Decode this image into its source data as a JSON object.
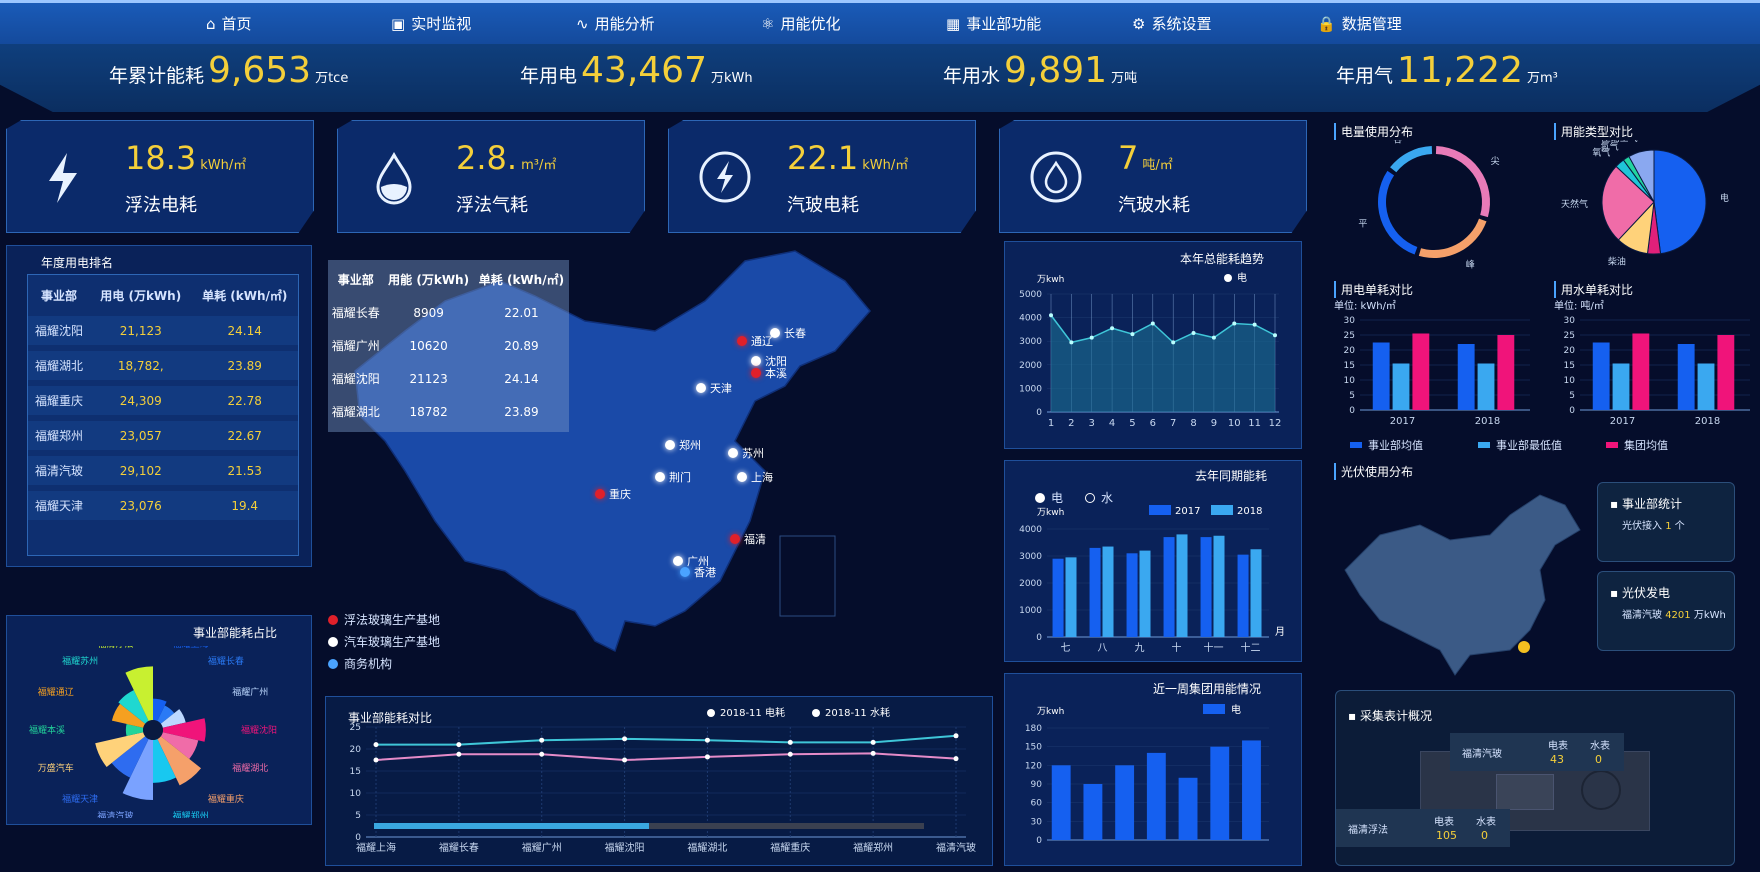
{
  "nav": [
    {
      "label": "首页",
      "icon": "home-icon"
    },
    {
      "label": "实时监视",
      "icon": "monitor-icon"
    },
    {
      "label": "用能分析",
      "icon": "pulse-icon"
    },
    {
      "label": "用能优化",
      "icon": "optimize-icon"
    },
    {
      "label": "事业部功能",
      "icon": "grid-icon"
    },
    {
      "label": "系统设置",
      "icon": "gear-icon"
    },
    {
      "label": "数据管理",
      "icon": "lock-icon"
    }
  ],
  "summary": [
    {
      "label": "年累计能耗",
      "value": "9,653",
      "unit": "万tce"
    },
    {
      "label": "年用电",
      "value": "43,467",
      "unit": "万kWh"
    },
    {
      "label": "年用水",
      "value": "9,891",
      "unit": "万吨"
    },
    {
      "label": "年用气",
      "value": "11,222",
      "unit": "万m³"
    }
  ],
  "kpis": [
    {
      "value": "18.3",
      "unit": "kWh/㎡",
      "label": "浮法电耗",
      "icon": "lightning-icon"
    },
    {
      "value": "2.8.",
      "unit": "m³/㎡",
      "label": "浮法气耗",
      "icon": "water-drop-icon"
    },
    {
      "value": "22.1",
      "unit": "kWh/㎡",
      "label": "汽玻电耗",
      "icon": "power-circle-icon"
    },
    {
      "value": "7",
      "unit": "吨/㎡",
      "label": "汽玻水耗",
      "icon": "water-circle-icon"
    }
  ],
  "ranking": {
    "title": "年度用电排名",
    "headers": [
      "事业部",
      "用电 (万kWh)",
      "单耗 (kWh/㎡)"
    ],
    "rows": [
      [
        "福耀沈阳",
        "21,123",
        "24.14"
      ],
      [
        "福耀湖北",
        "18,782,",
        "23.89"
      ],
      [
        "福耀重庆",
        "24,309",
        "22.78"
      ],
      [
        "福耀郑州",
        "23,057",
        "22.67"
      ],
      [
        "福清汽玻",
        "29,102",
        "21.53"
      ],
      [
        "福耀天津",
        "23,076",
        "19.4"
      ]
    ]
  },
  "map": {
    "overlay": {
      "headers": [
        "事业部",
        "用能 (万kWh)",
        "单耗 (kWh/㎡)"
      ],
      "rows": [
        [
          "福耀长春",
          "8909",
          "22.01"
        ],
        [
          "福耀广州",
          "10620",
          "20.89"
        ],
        [
          "福耀沈阳",
          "21123",
          "24.14"
        ],
        [
          "福耀湖北",
          "18782",
          "23.89"
        ]
      ]
    },
    "legend": [
      {
        "label": "浮法玻璃生产基地",
        "color": "#e0202a"
      },
      {
        "label": "汽车玻璃生产基地",
        "color": "#ffffff"
      },
      {
        "label": "商务机构",
        "color": "#4aa3ff"
      }
    ],
    "cities": [
      {
        "name": "长春",
        "type": 1
      },
      {
        "name": "通辽",
        "type": 0
      },
      {
        "name": "沈阳",
        "type": 1
      },
      {
        "name": "本溪",
        "type": 0
      },
      {
        "name": "天津",
        "type": 1
      },
      {
        "name": "郑州",
        "type": 1
      },
      {
        "name": "苏州",
        "type": 1
      },
      {
        "name": "荆门",
        "type": 1
      },
      {
        "name": "上海",
        "type": 1
      },
      {
        "name": "重庆",
        "type": 0
      },
      {
        "name": "福清",
        "type": 0
      },
      {
        "name": "广州",
        "type": 1
      },
      {
        "name": "香港",
        "type": 2
      }
    ]
  },
  "rose": {
    "title": "事业部能耗占比"
  },
  "trend": {
    "title": "本年总能耗趋势"
  },
  "lastyear": {
    "title": "去年同期能耗",
    "toggle": [
      {
        "label": "电",
        "active": true
      },
      {
        "label": "水",
        "active": false
      }
    ]
  },
  "week": {
    "title": "近一周集团用能情况"
  },
  "compare": {
    "title": "事业部能耗对比"
  },
  "right": {
    "donut_title": "电量使用分布",
    "pie_title": "用能类型对比",
    "elec_title": "用电单耗对比",
    "elec_unit": "单位: kWh/㎡",
    "water_title": "用水单耗对比",
    "water_unit": "单位: 吨/㎡",
    "bar_legend": [
      {
        "label": "事业部均值",
        "color": "#1560f0"
      },
      {
        "label": "事业部最低值",
        "color": "#3aa8f0"
      },
      {
        "label": "集团均值",
        "color": "#f0147a"
      }
    ]
  },
  "pv": {
    "title": "光伏使用分布",
    "stat_title": "事业部统计",
    "stat_label": "光伏接入",
    "stat_value": "1",
    "stat_unit": "个",
    "gen_title": "光伏发电",
    "gen_label": "福清汽玻",
    "gen_value": "4201",
    "gen_unit": "万kWh"
  },
  "meters": {
    "title": "采集表计概况",
    "sites": [
      {
        "name": "福清汽玻",
        "elec_label": "电表",
        "elec": "43",
        "water_label": "水表",
        "water": "0"
      },
      {
        "name": "福清浮法",
        "elec_label": "电表",
        "elec": "105",
        "water_label": "水表",
        "water": "0"
      }
    ]
  },
  "chart_data": [
    {
      "id": "trend",
      "type": "area",
      "ylabel": "万kwh",
      "x": [
        "1",
        "2",
        "3",
        "4",
        "5",
        "6",
        "7",
        "8",
        "9",
        "10",
        "11",
        "12"
      ],
      "series": [
        {
          "name": "电",
          "values": [
            4100,
            2950,
            3150,
            3550,
            3300,
            3750,
            2950,
            3350,
            3150,
            3750,
            3700,
            3250
          ]
        }
      ],
      "ylim": [
        0,
        5000
      ],
      "yticks": [
        0,
        1000,
        2000,
        3000,
        4000,
        5000
      ],
      "color": "#3fc6d8",
      "legend": "top-right"
    },
    {
      "id": "lastyear",
      "type": "bar",
      "ylabel": "万kwh",
      "xlabel": "月",
      "categories": [
        "七",
        "八",
        "九",
        "十",
        "十一",
        "十二"
      ],
      "series": [
        {
          "name": "2017",
          "values": [
            2900,
            3300,
            3100,
            3700,
            3700,
            3050
          ],
          "color": "#1560f0"
        },
        {
          "name": "2018",
          "values": [
            2950,
            3350,
            3200,
            3800,
            3750,
            3250
          ],
          "color": "#3aa8f0"
        }
      ],
      "ylim": [
        0,
        4000
      ],
      "yticks": [
        0,
        1000,
        2000,
        3000,
        4000
      ],
      "legend": "top-right"
    },
    {
      "id": "week",
      "type": "bar",
      "ylabel": "万kwh",
      "categories": [
        "",
        "",
        "",
        "",
        "",
        "",
        ""
      ],
      "series": [
        {
          "name": "电",
          "values": [
            120,
            90,
            120,
            140,
            100,
            150,
            160
          ],
          "color": "#1560f0"
        }
      ],
      "ylim": [
        0,
        180
      ],
      "yticks": [
        0,
        30,
        60,
        90,
        120,
        150,
        180
      ],
      "legend": "top-right"
    },
    {
      "id": "compare",
      "type": "line",
      "categories": [
        "福耀上海",
        "福耀长春",
        "福耀广州",
        "福耀沈阳",
        "福耀湖北",
        "福耀重庆",
        "福耀郑州",
        "福清汽玻"
      ],
      "series": [
        {
          "name": "2018-11 电耗",
          "values": [
            21,
            21,
            22,
            22.3,
            22,
            21.5,
            21.5,
            23
          ],
          "color": "#3fc6d8"
        },
        {
          "name": "2018-11 水耗",
          "values": [
            17.5,
            18.8,
            18.8,
            17.5,
            18.2,
            18.8,
            19,
            17.8
          ],
          "color": "#e58cc8"
        }
      ],
      "ylim": [
        0,
        25
      ],
      "yticks": [
        0,
        5,
        10,
        15,
        20,
        25
      ],
      "zoom_range": [
        0,
        50
      ],
      "legend": "top-right"
    },
    {
      "id": "elec",
      "type": "bar",
      "categories": [
        "2017",
        "2018"
      ],
      "series": [
        {
          "name": "事业部均值",
          "values": [
            22.5,
            22
          ]
        },
        {
          "name": "事业部最低值",
          "values": [
            15.5,
            15.5
          ]
        },
        {
          "name": "集团均值",
          "values": [
            25.5,
            25
          ]
        }
      ],
      "ylim": [
        0,
        30
      ],
      "yticks": [
        0,
        5,
        10,
        15,
        20,
        25,
        30
      ]
    },
    {
      "id": "water",
      "type": "bar",
      "categories": [
        "2017",
        "2018"
      ],
      "series": [
        {
          "name": "事业部均值",
          "values": [
            22.5,
            22
          ]
        },
        {
          "name": "事业部最低值",
          "values": [
            15.5,
            15.5
          ]
        },
        {
          "name": "集团均值",
          "values": [
            25.5,
            25
          ]
        }
      ],
      "ylim": [
        0,
        30
      ],
      "yticks": [
        0,
        5,
        10,
        15,
        20,
        25,
        30
      ]
    },
    {
      "id": "donut",
      "type": "pie",
      "labels": [
        "尖",
        "峰",
        "平",
        "谷"
      ],
      "values": [
        30,
        25,
        30,
        15
      ],
      "colors": [
        "#e87bb8",
        "#f5a06a",
        "#1560f0",
        "#3aa8f0"
      ]
    },
    {
      "id": "pie",
      "type": "pie",
      "labels": [
        "电",
        "",
        "柴油",
        "天然气",
        "氧气",
        "氮气",
        "压缩空气"
      ],
      "values": [
        48,
        4,
        10,
        25,
        3,
        2,
        8
      ],
      "colors": [
        "#1560f0",
        "#e0207a",
        "#ffd27a",
        "#f06ca8",
        "#1fc6d8",
        "#22d4a0",
        "#8aa8f0"
      ]
    },
    {
      "id": "rose",
      "type": "pie",
      "labels": [
        "福耀上海",
        "福耀长春",
        "福耀广州",
        "福耀沈阳",
        "福耀湖北",
        "福耀重庆",
        "福耀郑州",
        "福清汽玻",
        "福耀天津",
        "万盛汽车",
        "福耀本溪",
        "福耀通辽",
        "福耀苏州",
        "福清浮法"
      ],
      "values": [
        20,
        16,
        22,
        40,
        34,
        48,
        40,
        56,
        40,
        46,
        16,
        30,
        32,
        50
      ],
      "colors": [
        "#1560f0",
        "#2a7af5",
        "#bcd8ff",
        "#f0147a",
        "#f06ca8",
        "#f5a06a",
        "#18c8f0",
        "#7aa2ff",
        "#2e6cf0",
        "#ffd27a",
        "#22d49a",
        "#f5a020",
        "#1fd8d0",
        "#c8f030"
      ]
    }
  ]
}
